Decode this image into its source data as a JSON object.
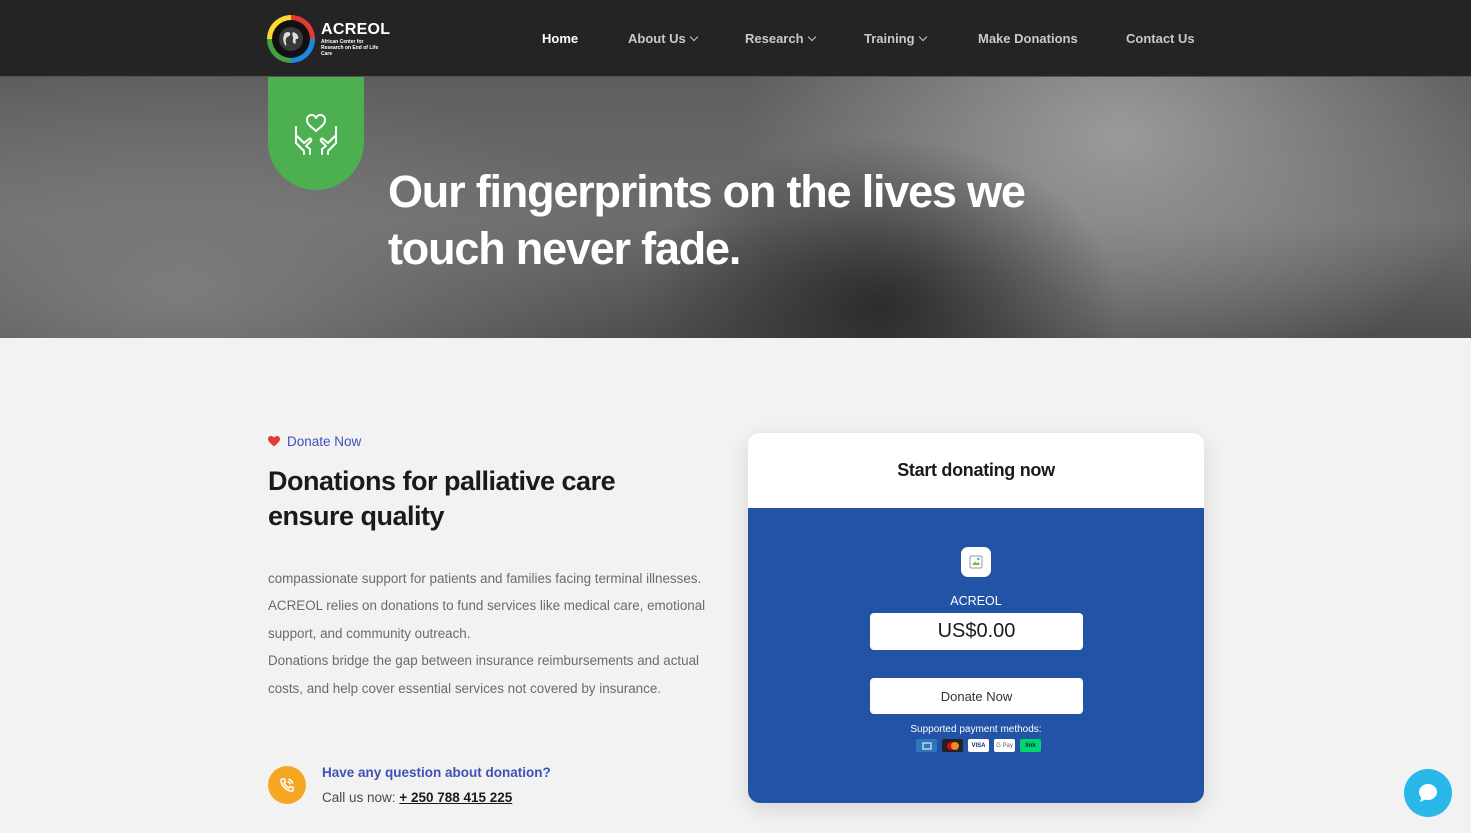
{
  "brand": {
    "name": "ACREOL",
    "tagline": "African Center for Research on End of Life Care"
  },
  "nav": {
    "items": [
      {
        "label": "Home",
        "active": true,
        "dropdown": false
      },
      {
        "label": "About Us",
        "active": false,
        "dropdown": true
      },
      {
        "label": "Research",
        "active": false,
        "dropdown": true
      },
      {
        "label": "Training",
        "active": false,
        "dropdown": true
      },
      {
        "label": "Make Donations",
        "active": false,
        "dropdown": false
      },
      {
        "label": "Contact Us",
        "active": false,
        "dropdown": false
      }
    ]
  },
  "hero": {
    "icon": "heart-hands-icon",
    "title": "Our fingerprints on the lives we touch never fade."
  },
  "donate_section": {
    "eyebrow": "Donate Now",
    "heading": "Donations for palliative care ensure quality",
    "paragraph_1": "compassionate support for patients and families facing terminal illnesses. ACREOL relies on donations to fund services like medical care, emotional support, and community outreach.",
    "paragraph_2": "Donations bridge the gap between insurance reimbursements and actual costs, and help cover essential services not covered by insurance.",
    "question": "Have any question about donation?",
    "call_label": "Call us now:",
    "phone": "+ 250 788 415 225"
  },
  "donation_card": {
    "title": "Start donating now",
    "org_name": "ACREOL",
    "amount": "US$0.00",
    "button": "Donate Now",
    "payment_label": "Supported payment methods:",
    "payment_methods": [
      "amex",
      "mastercard",
      "VISA",
      "G Pay",
      "link"
    ]
  },
  "colors": {
    "nav_bg": "#242424",
    "accent_green": "#4caf50",
    "accent_blue": "#3f51b5",
    "card_blue": "#2353a6",
    "phone_orange": "#f5a623",
    "chat_cyan": "#29b6e8",
    "heart_red": "#e53935"
  }
}
